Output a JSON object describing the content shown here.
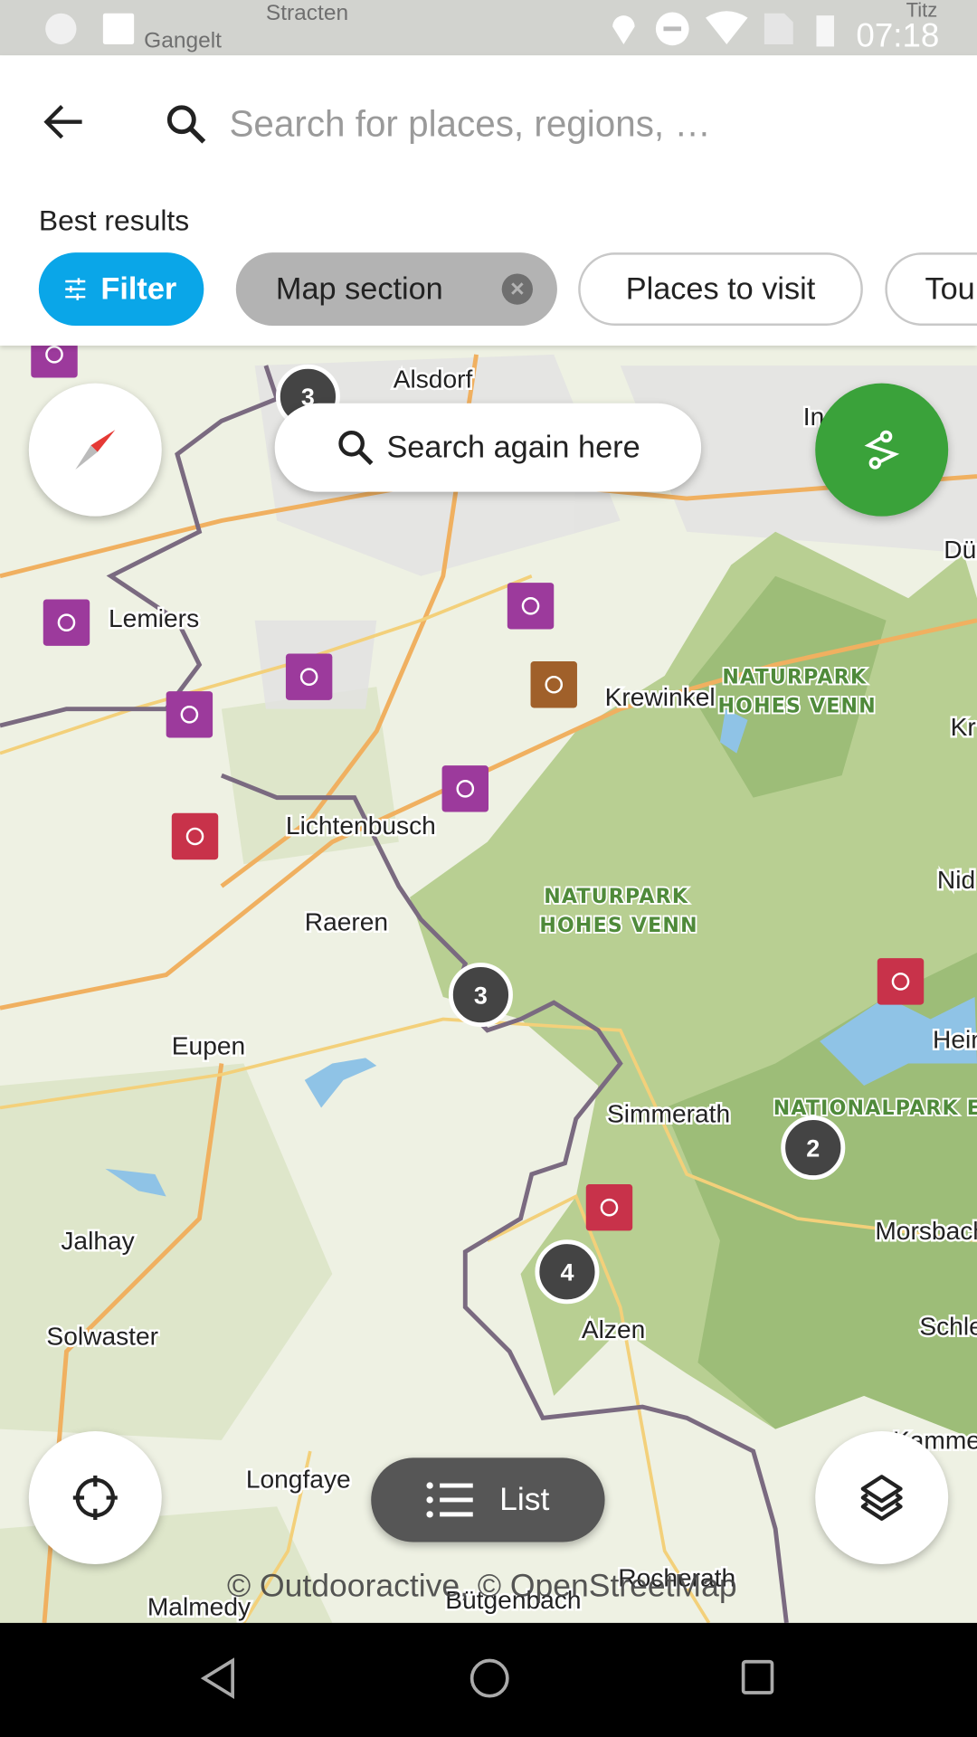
{
  "status_bar": {
    "time": "07:18",
    "icons": [
      "loading-icon",
      "image-icon",
      "location-icon",
      "do-not-disturb-icon",
      "wifi-icon",
      "no-sim-icon",
      "battery-charging-icon"
    ]
  },
  "header": {
    "search_placeholder": "Search for places, regions, …",
    "section_title": "Best results"
  },
  "chips": {
    "filter": "Filter",
    "map_section": "Map section",
    "places": "Places to visit",
    "tours": "Tou"
  },
  "map": {
    "search_again": "Search again here",
    "list_label": "List",
    "attribution": "© Outdooractive, © OpenStreetMap",
    "places": [
      "Alsdorf",
      "Lemiers",
      "Krewinkel",
      "Lichtenbusch",
      "Raeren",
      "Eupen",
      "Simmerath",
      "Morsbach",
      "Jalhay",
      "Alzen",
      "Solwaster",
      "Longfaye",
      "Malmedy",
      "Bütgenbach",
      "Rocherath",
      "Dü",
      "Kr",
      "Nid",
      "Hein",
      "Schle",
      "Kammer",
      "In",
      "Gangelt",
      "Titz",
      "Stracten"
    ],
    "parks": [
      "NATURPARK",
      "HOHES VENN",
      "NATURPARK",
      "HOHES VENN",
      "NATIONALPARK E"
    ],
    "clusters": [
      "3",
      "3",
      "2",
      "4"
    ],
    "colors": {
      "cycling": "#9c3a9c",
      "hiking": "#c8324a",
      "sight": "#a0602a",
      "green_button": "#3aa23a",
      "filter": "#0aa6e8"
    }
  }
}
